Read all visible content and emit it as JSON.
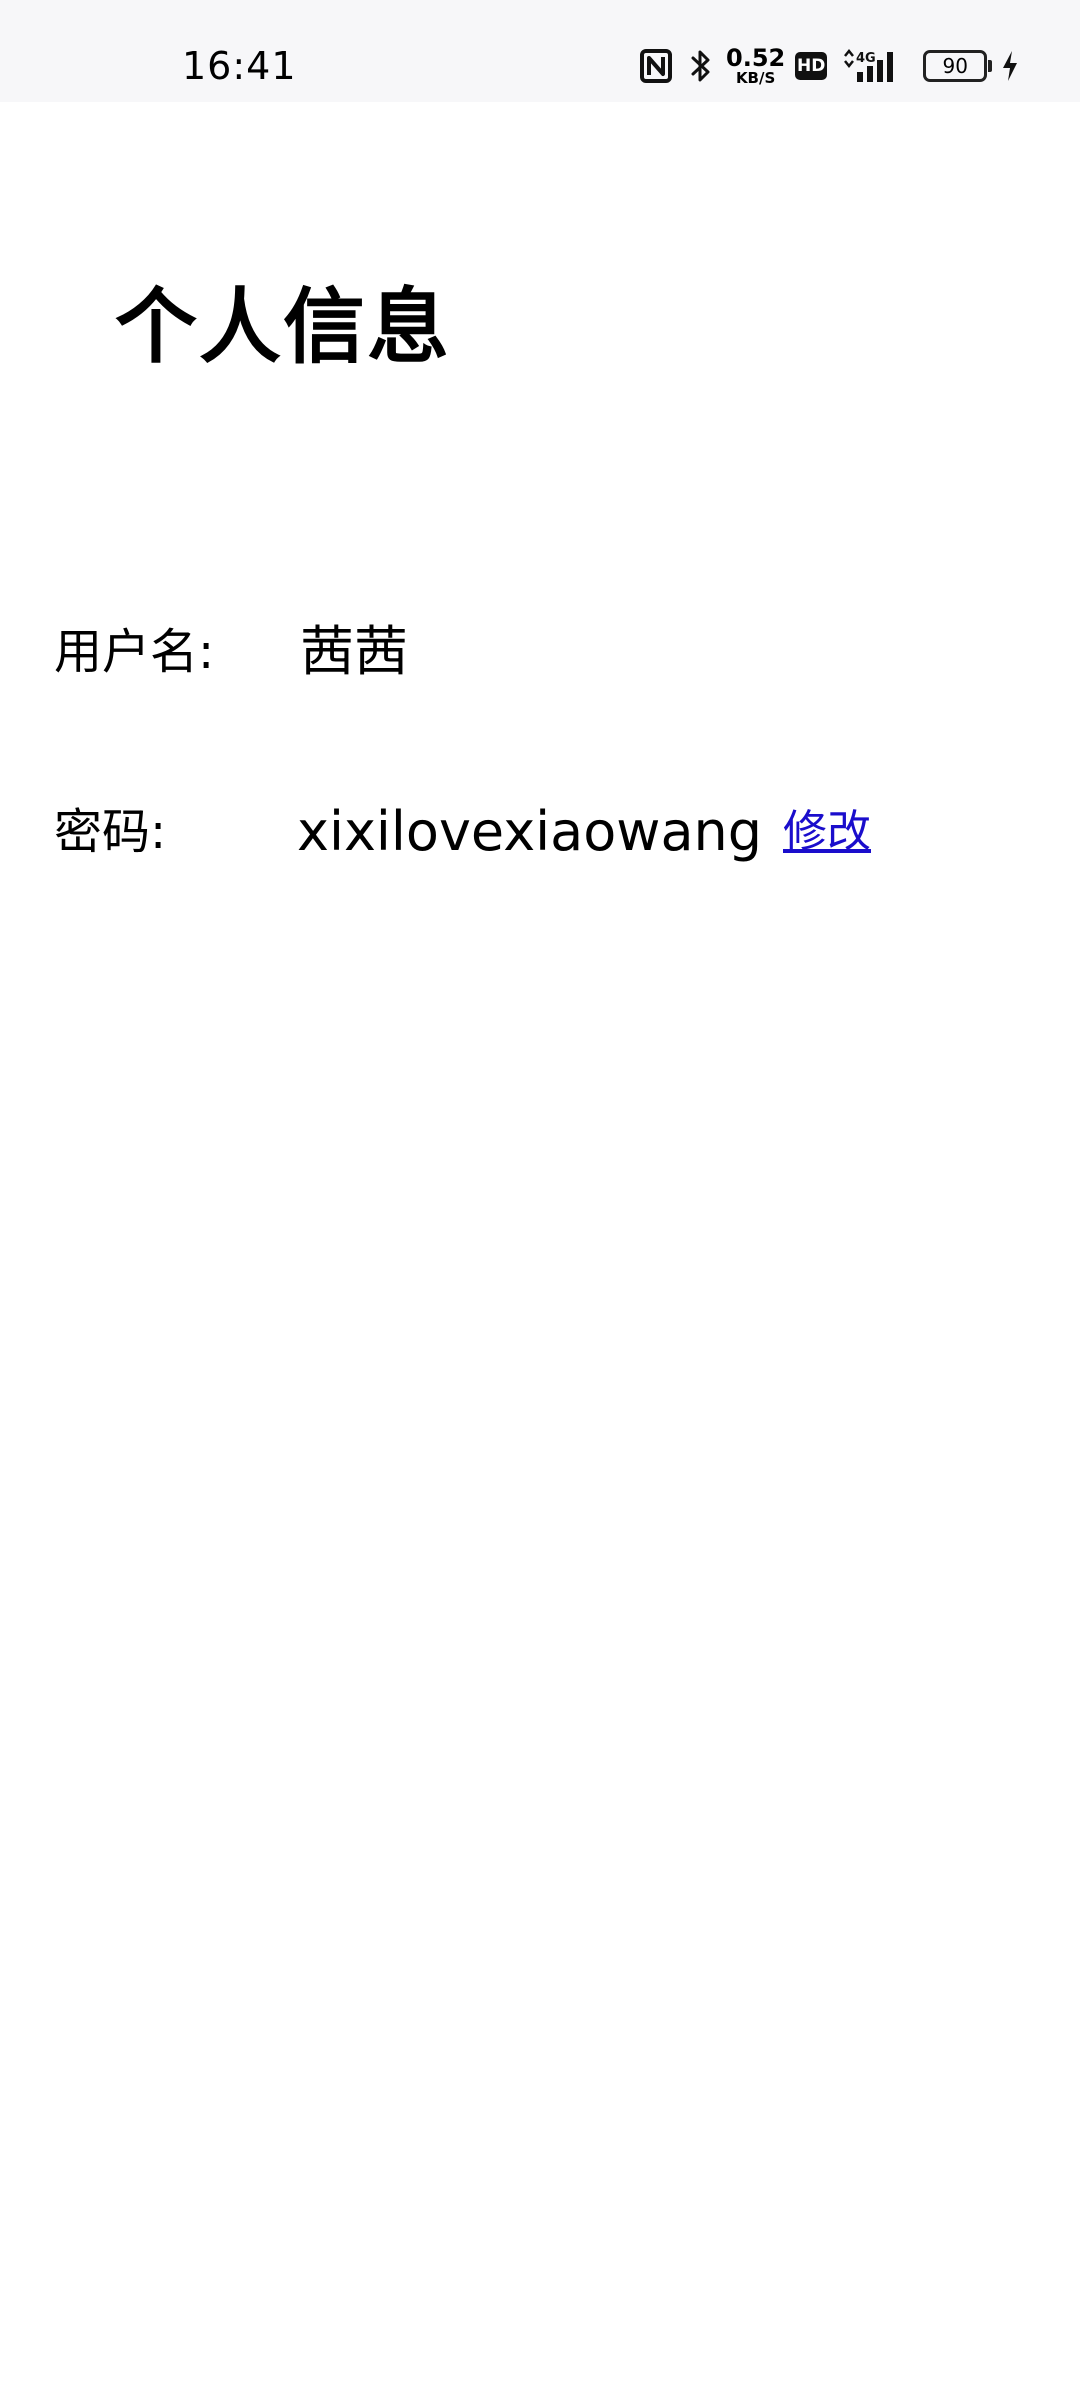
{
  "status_bar": {
    "time": "16:41",
    "network_speed_value": "0.52",
    "network_speed_unit": "KB/S",
    "hd_label": "HD",
    "signal_label": "4G",
    "battery_level": "90",
    "icons": [
      "nfc-icon",
      "bluetooth-icon",
      "hd-icon",
      "signal-4g-icon",
      "battery-icon",
      "charging-icon"
    ]
  },
  "page": {
    "title": "个人信息"
  },
  "profile": {
    "username_label": "用户名:",
    "username_value": "茜茜",
    "password_label": "密码:",
    "password_value": "xixilovexiaowang",
    "modify_link": "修改"
  },
  "colors": {
    "link": "#1a0dcc",
    "status_bar_bg": "#f7f7f9"
  }
}
